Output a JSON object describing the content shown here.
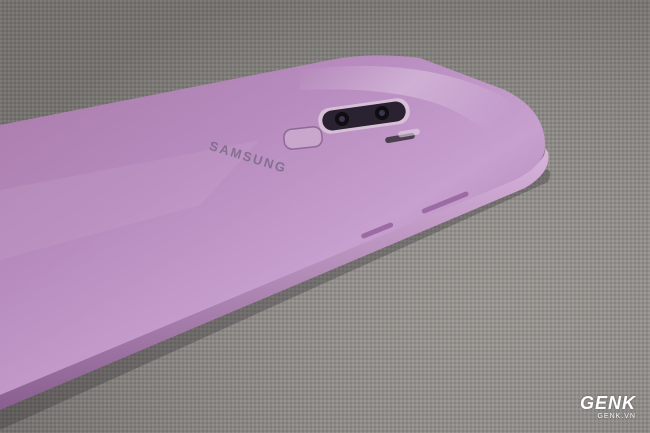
{
  "photo": {
    "subject": "smartphone-back",
    "colors": {
      "phone_body": "#b78cbf",
      "phone_highlight": "#e3c4e6",
      "fabric": "#8d8a86",
      "camera_module": "#2a2230"
    }
  },
  "phone_brand_text": "SAMSUNG",
  "watermark": {
    "logo": "GENK",
    "url": "GENK.VN"
  }
}
